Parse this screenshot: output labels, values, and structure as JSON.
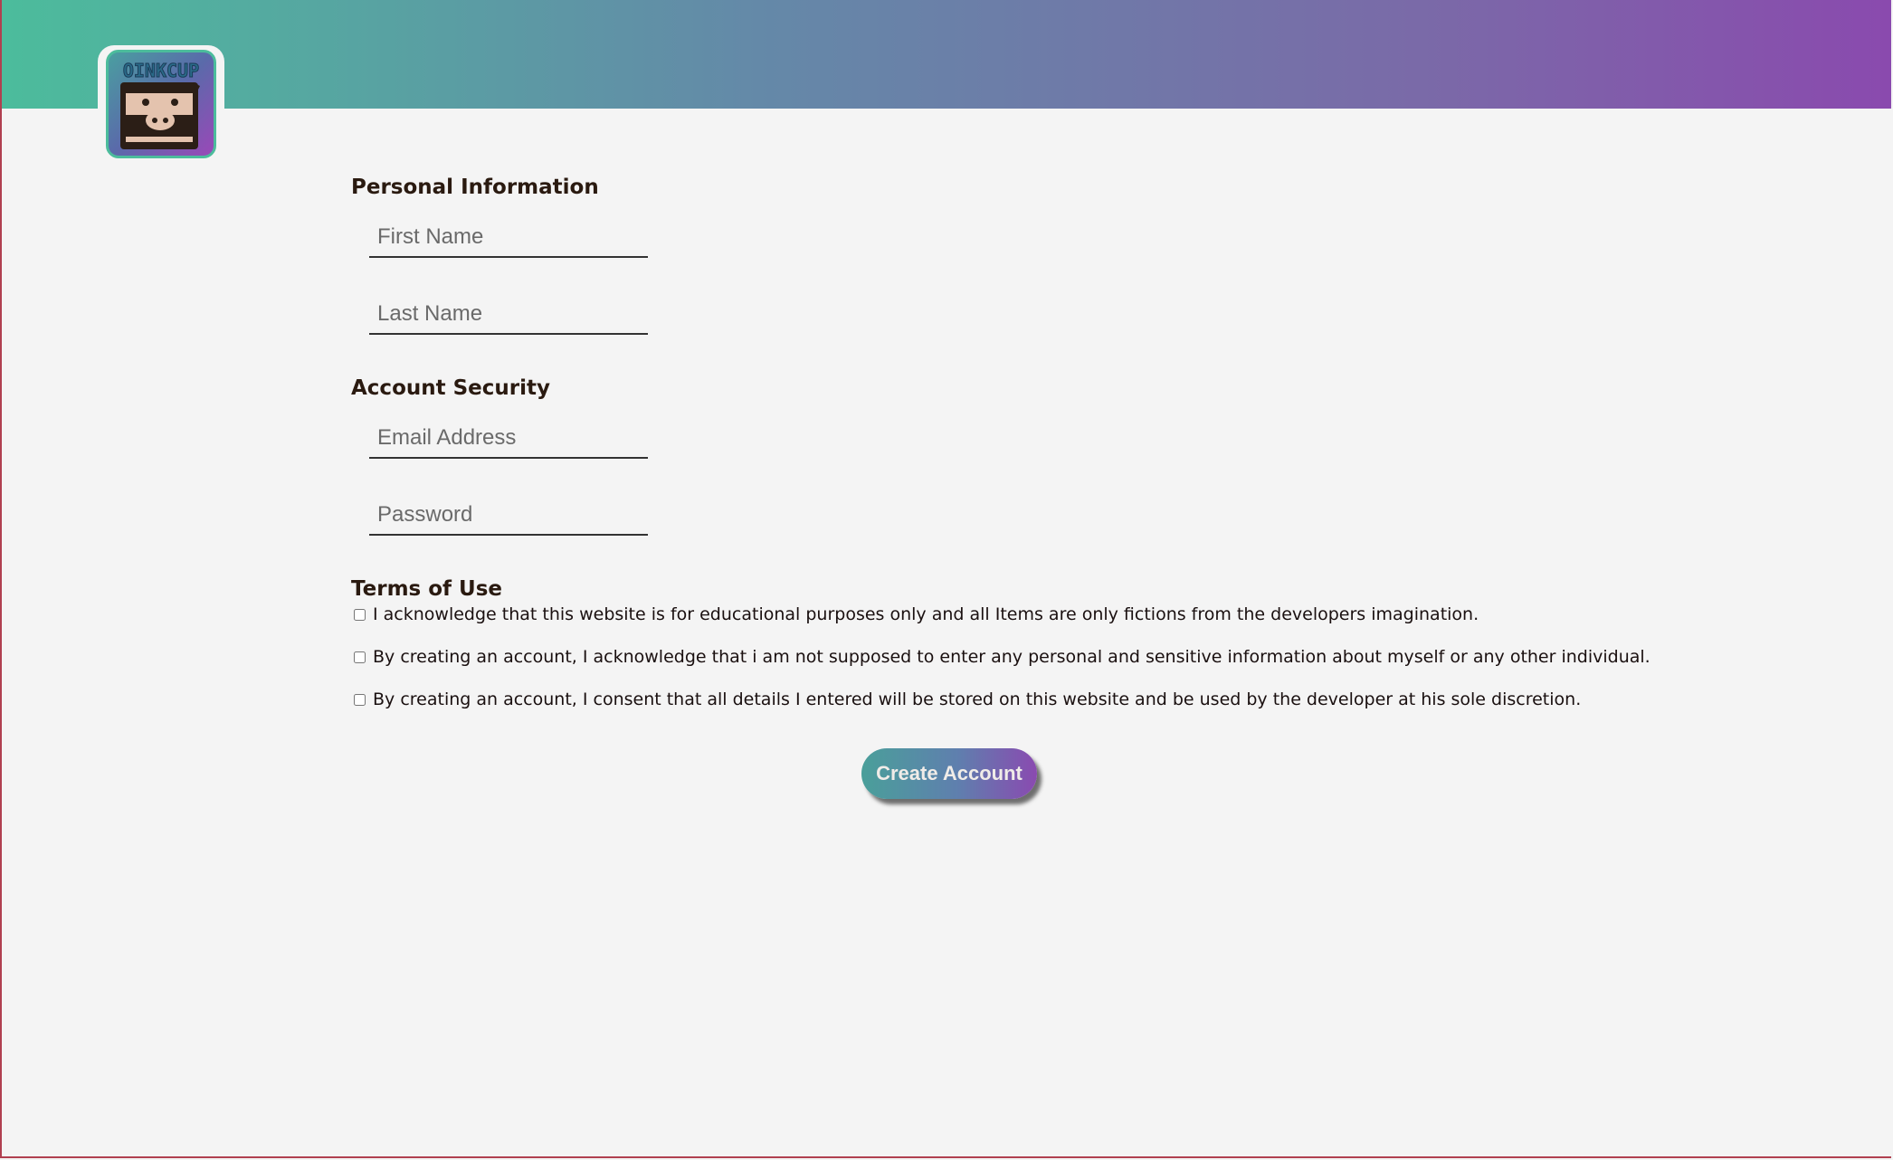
{
  "brand": {
    "logo_text": "OINKCUP"
  },
  "sections": {
    "personal": {
      "heading": "Personal Information",
      "first_name_placeholder": "First Name",
      "last_name_placeholder": "Last Name"
    },
    "security": {
      "heading": "Account Security",
      "email_placeholder": "Email Address",
      "password_placeholder": "Password"
    },
    "terms": {
      "heading": "Terms of Use",
      "items": [
        {
          "label": "I acknowledge that this website is for educational purposes only and all Items are only fictions from the developers imagination.",
          "checked": false
        },
        {
          "label": "By creating an account, I acknowledge that i am not supposed to enter any personal and sensitive information about myself or any other individual.",
          "checked": false
        },
        {
          "label": "By creating an account, I consent that all details I entered will be stored on this website and be used by the developer at his sole discretion.",
          "checked": false
        }
      ]
    }
  },
  "actions": {
    "create_account_label": "Create Account"
  },
  "colors": {
    "banner_start": "#4cbc9c",
    "banner_end": "#8a4aae",
    "background": "#f4f4f4",
    "heading_text": "#2a1a10"
  }
}
